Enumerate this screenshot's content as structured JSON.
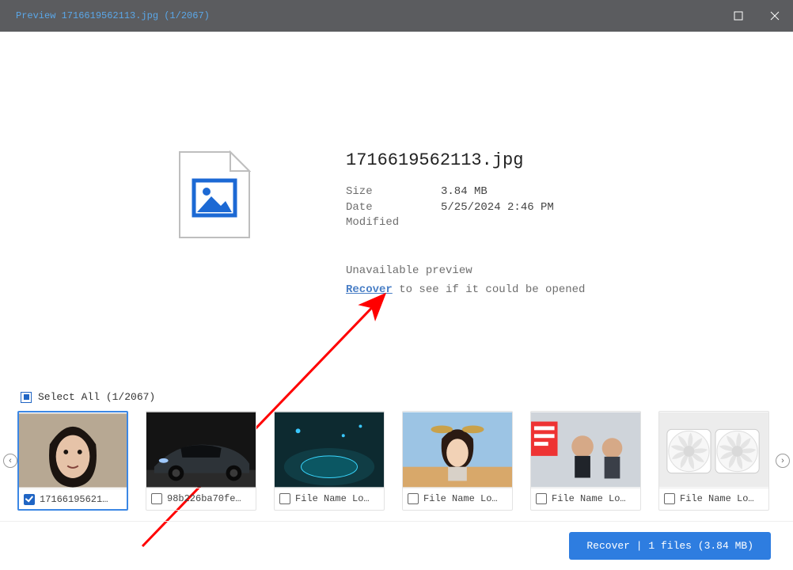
{
  "titlebar": {
    "text": "Preview 1716619562113.jpg (1/2067)"
  },
  "file": {
    "name": "1716619562113.jpg",
    "size_label": "Size",
    "size_value": "3.84 MB",
    "date_label": "Date Modified",
    "date_value": "5/25/2024 2:46 PM",
    "unavailable": "Unavailable preview",
    "recover_link": "Recover",
    "recover_suffix": " to see if it could be opened"
  },
  "select_all": {
    "label": "Select All (1/2067)"
  },
  "thumbs": [
    {
      "label": "17166195621…",
      "checked": true,
      "selected": true
    },
    {
      "label": "98b226ba70fe…",
      "checked": false,
      "selected": false
    },
    {
      "label": "File Name Lo…",
      "checked": false,
      "selected": false
    },
    {
      "label": "File Name Lo…",
      "checked": false,
      "selected": false
    },
    {
      "label": "File Name Lo…",
      "checked": false,
      "selected": false
    },
    {
      "label": "File Name Lo…",
      "checked": false,
      "selected": false
    }
  ],
  "footer": {
    "recover": "Recover | 1 files (3.84 MB)"
  }
}
